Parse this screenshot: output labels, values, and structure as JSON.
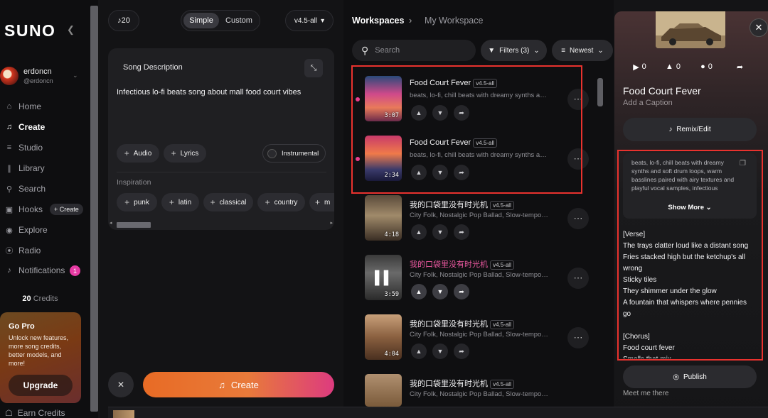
{
  "sidebar": {
    "logo": "SUNO",
    "user": {
      "name": "erdoncn",
      "handle": "@erdoncn"
    },
    "nav": [
      {
        "label": "Home",
        "icon": "home-icon",
        "active": false
      },
      {
        "label": "Create",
        "icon": "music-note-icon",
        "active": true
      },
      {
        "label": "Studio",
        "icon": "sliders-icon",
        "active": false
      },
      {
        "label": "Library",
        "icon": "library-icon",
        "active": false
      },
      {
        "label": "Search",
        "icon": "search-icon",
        "active": false
      },
      {
        "label": "Hooks",
        "icon": "hooks-icon",
        "active": false
      },
      {
        "label": "Explore",
        "icon": "compass-icon",
        "active": false
      },
      {
        "label": "Radio",
        "icon": "radio-icon",
        "active": false
      },
      {
        "label": "Notifications",
        "icon": "bell-icon",
        "active": false
      }
    ],
    "hooks_create": "+ Create",
    "notifications_count": "1",
    "credits_amount": "20",
    "credits_label": "Credits",
    "gopro": {
      "title": "Go Pro",
      "description": "Unlock new features, more song credits, better models, and more!",
      "button": "Upgrade"
    },
    "earn_credits": "Earn Credits"
  },
  "create": {
    "credits": "20",
    "mode_simple": "Simple",
    "mode_custom": "Custom",
    "version": "v4.5-all",
    "song_description_label": "Song Description",
    "song_description": "Infectious lo-fi beats song about mall food court vibes",
    "chips": [
      "Audio",
      "Lyrics"
    ],
    "instrumental": "Instrumental",
    "inspiration_label": "Inspiration",
    "inspiration": [
      "punk",
      "latin",
      "classical",
      "country",
      "m"
    ],
    "create_button": "Create"
  },
  "workspace": {
    "breadcrumb": [
      "Workspaces",
      "My Workspace"
    ],
    "search_placeholder": "Search",
    "filters": "Filters (3)",
    "sort": "Newest",
    "songs": [
      {
        "title": "Food Court Fever",
        "version": "v4.5-all",
        "tags": "beats, lo-fi, chill beats with dreamy synths and sof...",
        "duration": "3:07",
        "new": true,
        "playing": false
      },
      {
        "title": "Food Court Fever",
        "version": "v4.5-all",
        "tags": "beats, lo-fi, chill beats with dreamy synths and sof...",
        "duration": "2:34",
        "new": true,
        "playing": false
      },
      {
        "title": "我的口袋里没有时光机",
        "version": "v4.5-all",
        "tags": "City Folk, Nostalgic Pop Ballad, Slow-tempo, abo...",
        "duration": "4:18",
        "new": false,
        "playing": false
      },
      {
        "title": "我的口袋里没有时光机",
        "version": "v4.5-all",
        "tags": "City Folk, Nostalgic Pop Ballad, Slow-tempo, abo...",
        "duration": "3:59",
        "new": false,
        "playing": true
      },
      {
        "title": "我的口袋里没有时光机",
        "version": "v4.5-all",
        "tags": "City Folk, Nostalgic Pop Ballad, Slow-tempo, abo...",
        "duration": "4:04",
        "new": false,
        "playing": false
      },
      {
        "title": "我的口袋里没有时光机",
        "version": "v4.5-all",
        "tags": "City Folk, Nostalgic Pop Ballad, Slow-tempo, abo...",
        "duration": "",
        "new": false,
        "playing": false
      }
    ]
  },
  "detail": {
    "plays": "0",
    "likes": "0",
    "comments": "0",
    "title": "Food Court Fever",
    "caption_placeholder": "Add a Caption",
    "remix": "Remix/Edit",
    "style": "beats, lo-fi, chill beats with dreamy synths and soft drum loops, warm basslines paired with airy textures and playful vocal samples, infectious",
    "show_more": "Show More",
    "lyrics": "[Verse]\nThe trays clatter loud like a distant song\nFries stacked high but the ketchup's all wrong\nSticky tiles\nThey shimmer under the glow\nA fountain that whispers where pennies go\n\n[Chorus]\nFood court fever\nSmells that mix",
    "publish": "Publish",
    "meet": "Meet me there"
  },
  "colors": {
    "accent_pink": "#ea3f8e",
    "create_gradient_start": "#e86b25",
    "create_gradient_end": "#dd3b7f",
    "annotation_red": "#e9322e"
  }
}
